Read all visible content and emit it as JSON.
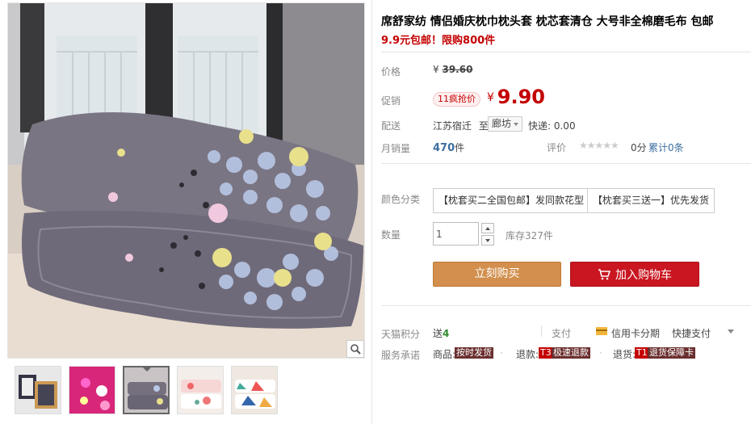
{
  "product": {
    "title": "席舒家纺 情侣婚庆枕巾枕头套 枕芯套清仓 大号非全棉磨毛布 包邮",
    "subtitle": "9.9元包邮！限购800件"
  },
  "price": {
    "label": "价格",
    "currency": "¥",
    "original": "39.60"
  },
  "promo": {
    "label": "促销",
    "tag": "11疯抢价",
    "currency": "¥",
    "price": "9.90"
  },
  "shipping": {
    "label": "配送",
    "from": "江苏宿迁",
    "to_word": "至",
    "to_value": "廊坊",
    "fee": "快递: 0.00"
  },
  "sales": {
    "label": "月销量",
    "count": "470",
    "unit": "件",
    "review_label": "评价",
    "stars": "★★★★★",
    "rating": 0,
    "score": "0分",
    "total": "累计0条"
  },
  "sku": {
    "label": "颜色分类",
    "options": [
      "【枕套买二全国包邮】发同款花型",
      "【枕套买三送一】优先发货"
    ]
  },
  "quantity": {
    "label": "数量",
    "value": "1",
    "stock": "库存327件"
  },
  "actions": {
    "buy": "立刻购买",
    "cart": "加入购物车"
  },
  "points": {
    "label": "天猫积分",
    "prefix": "送",
    "value": "4",
    "pay_label": "支付",
    "installment": "信用卡分期",
    "quickpay": "快捷支付"
  },
  "service": {
    "label": "服务承诺",
    "goods_prefix": "商品:",
    "goods_tag": "按时发货",
    "refund_prefix": "退款:",
    "refund_code": "T3",
    "refund_tag": "极速退款",
    "return_prefix": "退货:",
    "return_code": "T1",
    "return_tag": "退货保障卡"
  },
  "colors": {
    "accent": "#c40000",
    "buy": "#d28f4d",
    "cart": "#c91620",
    "link": "#3c6e9e"
  }
}
